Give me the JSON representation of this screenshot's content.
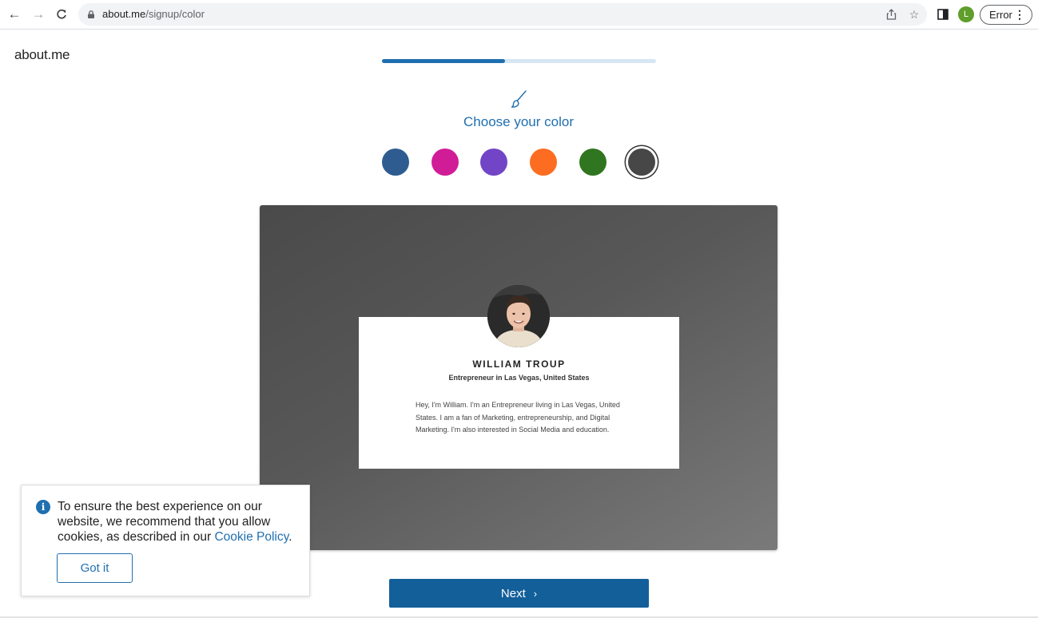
{
  "browser": {
    "url_host": "about.me",
    "url_path": "/signup/color",
    "profile_initial": "L",
    "profile_color": "#5f9e2b",
    "error_label": "Error"
  },
  "page": {
    "logo": "about.me",
    "progress_fraction": 0.45,
    "step_icon": "paintbrush-icon",
    "title": "Choose your color",
    "accent_color": "#1f6fb0",
    "swatches": [
      {
        "name": "blue",
        "color": "#2e5c91"
      },
      {
        "name": "magenta",
        "color": "#d11c98"
      },
      {
        "name": "purple",
        "color": "#7145c6"
      },
      {
        "name": "orange",
        "color": "#fd6d21"
      },
      {
        "name": "green",
        "color": "#307620"
      },
      {
        "name": "dark-gray",
        "color": "#474747",
        "selected": true
      }
    ]
  },
  "preview": {
    "name": "WILLIAM TROUP",
    "role": "Entrepreneur in Las Vegas, United States",
    "bio": "Hey, I'm William. I'm an Entrepreneur living in Las Vegas, United States. I am a fan of Marketing, entrepreneurship, and Digital Marketing. I'm also interested in Social Media and education."
  },
  "cookie_banner": {
    "text_before_link": "To ensure the best experience on our website, we recommend that you allow cookies, as described in our ",
    "link_text": "Cookie Policy",
    "text_after_link": ".",
    "button_label": "Got it"
  },
  "footer": {
    "next_label": "Next",
    "next_icon": "chevron-right-icon"
  }
}
